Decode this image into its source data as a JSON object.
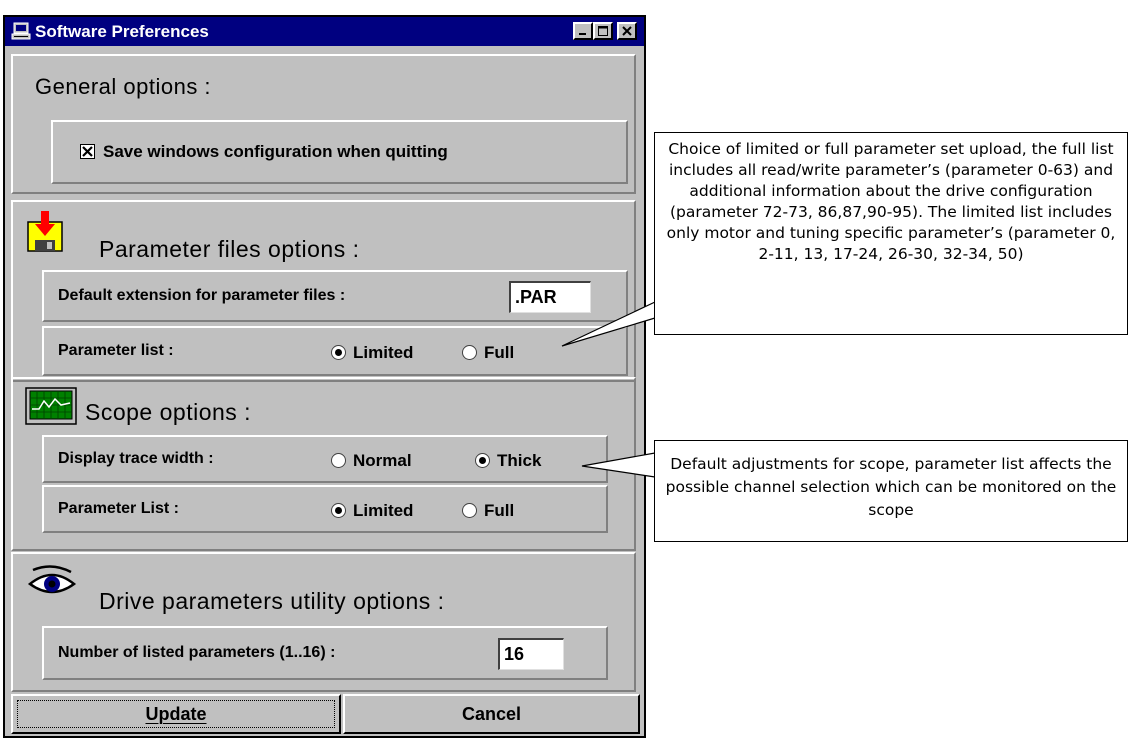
{
  "window": {
    "title": "Software Preferences"
  },
  "general": {
    "heading": "General options :",
    "save_config_label": "Save windows configuration when quitting",
    "save_config_checked": true
  },
  "parameter_files": {
    "heading": "Parameter files options :",
    "default_ext_label": "Default extension for parameter files :",
    "default_ext_value": ".PAR",
    "param_list_label": "Parameter list :",
    "option_limited": "Limited",
    "option_full": "Full",
    "selected": "Limited"
  },
  "scope": {
    "heading": "Scope options :",
    "trace_width_label": "Display trace width :",
    "option_normal": "Normal",
    "option_thick": "Thick",
    "trace_selected": "Thick",
    "param_list_label": "Parameter List :",
    "option_limited": "Limited",
    "option_full": "Full",
    "list_selected": "Limited"
  },
  "drive": {
    "heading": "Drive parameters utility options :",
    "num_params_label": "Number of listed parameters (1..16) :",
    "num_params_value": "16"
  },
  "buttons": {
    "update_label": "Update",
    "cancel_label": "Cancel"
  },
  "callouts": {
    "parameter_list_note": "Choice of limited or full parameter set upload, the full list includes all read/write parameter’s (parameter 0-63) and additional information about the drive configuration (parameter 72-73, 86,87,90-95). The limited list includes only motor and tuning specific parameter’s (parameter 0, 2-11, 13, 17-24, 26-30, 32-34, 50)",
    "scope_note": "Default adjustments for scope, parameter list affects the possible channel selection which can be monitored on the scope"
  },
  "colors": {
    "titlebar": "#000080",
    "face": "#c0c0c0"
  },
  "icons": [
    "computer-icon",
    "minimize-icon",
    "maximize-icon",
    "close-icon",
    "floppy-disk-icon",
    "oscilloscope-icon",
    "eye-icon"
  ]
}
